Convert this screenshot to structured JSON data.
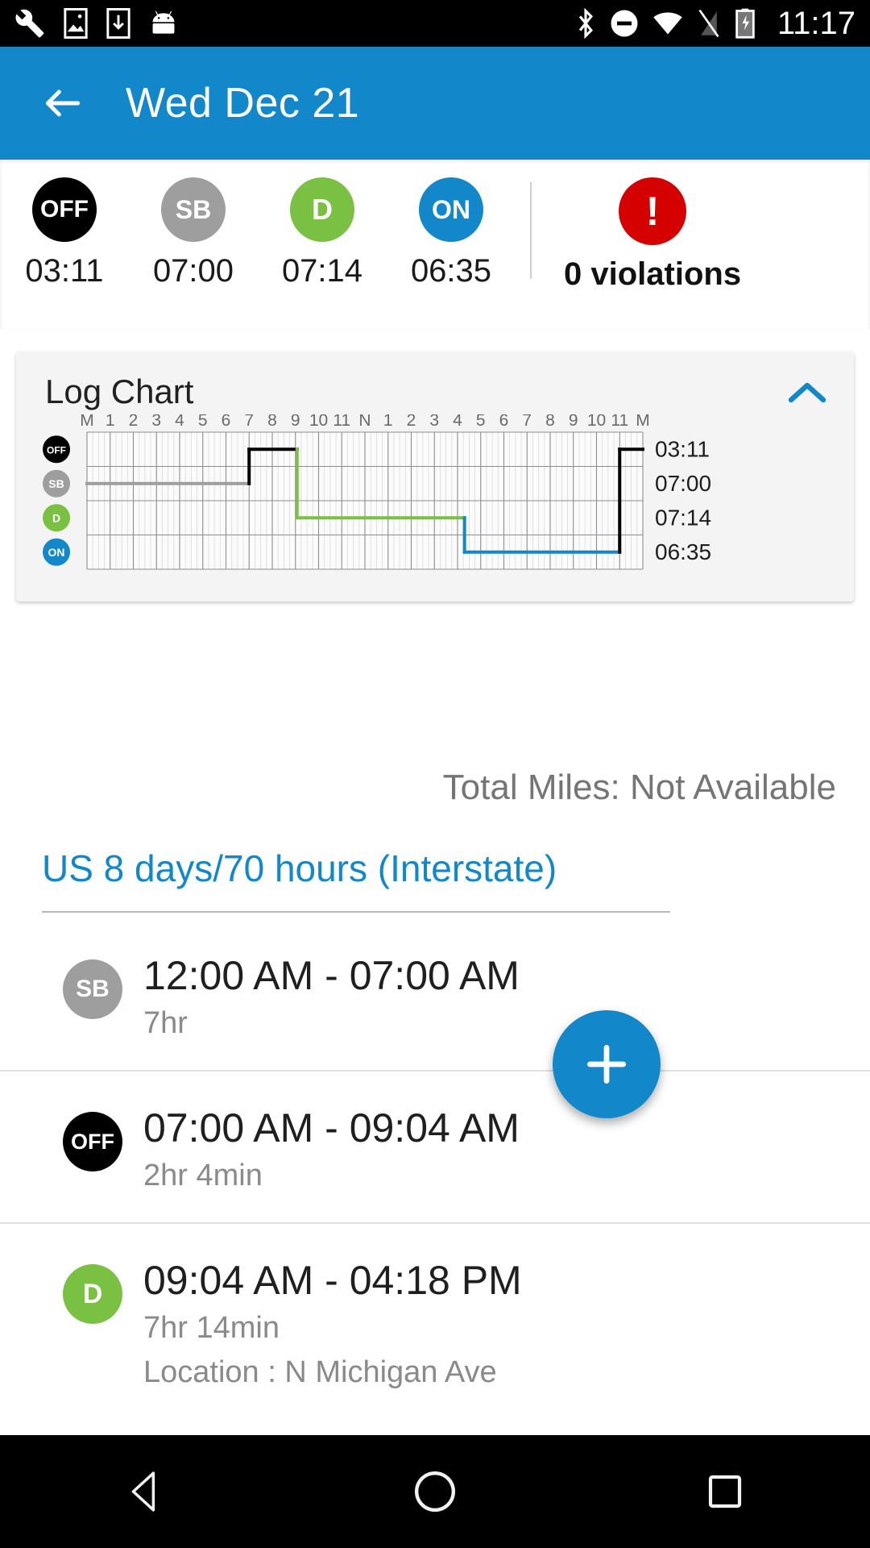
{
  "status_bar": {
    "clock": "11:17",
    "left_icons": [
      "wrench-icon",
      "screenshot-icon",
      "download-icon",
      "android-icon"
    ],
    "right_icons": [
      "bluetooth-icon",
      "do-not-disturb-icon",
      "wifi-icon",
      "signal-off-icon",
      "battery-charging-icon"
    ]
  },
  "app_bar": {
    "back_label": "back-arrow",
    "title": "Wed Dec 21"
  },
  "summary": {
    "statuses": [
      {
        "code": "OFF",
        "time": "03:11",
        "color": "#000000"
      },
      {
        "code": "SB",
        "time": "07:00",
        "color": "#9e9e9e"
      },
      {
        "code": "D",
        "time": "07:14",
        "color": "#7ac143"
      },
      {
        "code": "ON",
        "time": "06:35",
        "color": "#1288ca"
      }
    ],
    "violations_text": "0 violations",
    "violations_color": "#d50000"
  },
  "log_chart_card": {
    "title": "Log Chart",
    "collapse_icon": "chevron-up-icon",
    "accent_color": "#1288ca"
  },
  "chart_data": {
    "type": "line",
    "title": "Log Chart",
    "xlabel": "",
    "ylabel": "",
    "x_tick_labels": [
      "M",
      "1",
      "2",
      "3",
      "4",
      "5",
      "6",
      "7",
      "8",
      "9",
      "10",
      "11",
      "N",
      "1",
      "2",
      "3",
      "4",
      "5",
      "6",
      "7",
      "8",
      "9",
      "10",
      "11",
      "M"
    ],
    "row_labels": [
      "OFF",
      "SB",
      "D",
      "ON"
    ],
    "row_totals": [
      "03:11",
      "07:00",
      "07:14",
      "06:35"
    ],
    "row_colors": [
      "#000000",
      "#9e9e9e",
      "#7ac143",
      "#1288ca"
    ],
    "xlim": [
      0,
      24
    ],
    "grid": true,
    "legend": "none",
    "segments": [
      {
        "status": "SB",
        "start_hour": 0,
        "end_hour": 7.0,
        "color": "#9e9e9e"
      },
      {
        "status": "OFF",
        "start_hour": 7.0,
        "end_hour": 9.07,
        "color": "#000000"
      },
      {
        "status": "D",
        "start_hour": 9.07,
        "end_hour": 16.3,
        "color": "#7ac143"
      },
      {
        "status": "ON",
        "start_hour": 16.3,
        "end_hour": 23.0,
        "color": "#1288ca"
      },
      {
        "status": "OFF",
        "start_hour": 23.0,
        "end_hour": 24.0,
        "color": "#000000"
      }
    ]
  },
  "total_miles": "Total Miles: Not Available",
  "cycle": {
    "title": "US 8 days/70 hours (Interstate)"
  },
  "log_entries": [
    {
      "status": "SB",
      "range": "12:00 AM - 07:00 AM",
      "duration": "7hr",
      "location": ""
    },
    {
      "status": "OFF",
      "range": "07:00 AM - 09:04 AM",
      "duration": "2hr 4min",
      "location": ""
    },
    {
      "status": "D",
      "range": "09:04 AM - 04:18 PM",
      "duration": "7hr 14min",
      "location": "Location : N Michigan Ave"
    }
  ],
  "fab": {
    "icon": "plus-icon",
    "color": "#1288ca"
  },
  "nav_bar": {
    "buttons": [
      "back-triangle-icon",
      "home-circle-icon",
      "recents-square-icon"
    ]
  }
}
